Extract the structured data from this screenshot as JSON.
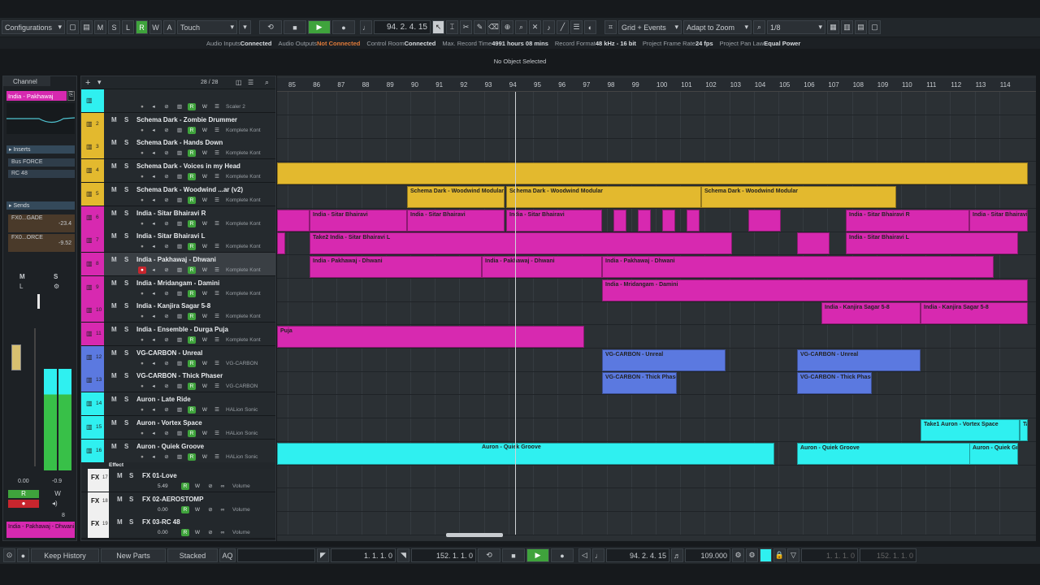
{
  "toolbar": {
    "configurations": "Configurations",
    "automation_mode": "Touch",
    "position": "94. 2. 4. 15",
    "snap_type": "Grid + Events",
    "zoom_mode": "Adapt to Zoom",
    "quantize": "1/8"
  },
  "info": {
    "audio_inputs_label": "Audio Inputs",
    "audio_inputs_value": "Connected",
    "audio_outputs_label": "Audio Outputs",
    "audio_outputs_value": "Not Connected",
    "control_room_label": "Control Room",
    "control_room_value": "Connected",
    "max_record_label": "Max. Record Time",
    "max_record_value": "4991 hours 08 mins",
    "record_format_label": "Record Format",
    "record_format_value": "48 kHz - 16 bit",
    "frame_rate_label": "Project Frame Rate",
    "frame_rate_value": "24 fps",
    "pan_law_label": "Project Pan Law",
    "pan_law_value": "Equal Power"
  },
  "object_line": "No Object Selected",
  "inspector": {
    "tab": "Channel",
    "track_name": "India - Pakhawaj",
    "inserts_label": "Inserts",
    "insert1": "Bus FORCE",
    "insert2": "RC 48",
    "sends_label": "Sends",
    "send1": "FX0...GADE",
    "send1_val": "-23.4",
    "send2": "FX0...ORCE",
    "send2_val": "-9.52",
    "fader_val": "0.00",
    "pan_val": "-0.9",
    "footer_name": "India - Pakhawaj - Dhwani",
    "count": "8"
  },
  "tracklist": {
    "counter": "28 / 28",
    "tracks": [
      {
        "num": "",
        "name": "",
        "inst": "Scaler 2"
      },
      {
        "num": "2",
        "name": "Schema Dark - Zombie Drummer",
        "inst": "Komplete Kont"
      },
      {
        "num": "3",
        "name": "Schema Dark - Hands Down",
        "inst": "Komplete Kont"
      },
      {
        "num": "4",
        "name": "Schema Dark - Voices in my Head",
        "inst": "Komplete Kont"
      },
      {
        "num": "5",
        "name": "Schema Dark - Woodwind ...ar (v2)",
        "inst": "Komplete Kont"
      },
      {
        "num": "6",
        "name": "India - Sitar Bhairavi R",
        "inst": "Komplete Kont"
      },
      {
        "num": "7",
        "name": "India - Sitar Bhairavi L",
        "inst": "Komplete Kont"
      },
      {
        "num": "8",
        "name": "India - Pakhawaj - Dhwani",
        "inst": "Komplete Kont"
      },
      {
        "num": "9",
        "name": "India - Mridangam - Damini",
        "inst": "Komplete Kont"
      },
      {
        "num": "10",
        "name": "India - Kanjira Sagar 5-8",
        "inst": "Komplete Kont"
      },
      {
        "num": "11",
        "name": "India - Ensemble - Durga Puja",
        "inst": "Komplete Kont"
      },
      {
        "num": "12",
        "name": "VG-CARBON - Unreal",
        "inst": "VG-CARBON"
      },
      {
        "num": "13",
        "name": "VG-CARBON - Thick Phaser",
        "inst": "VG-CARBON"
      },
      {
        "num": "14",
        "name": "Auron - Late Ride",
        "inst": "HALion Sonic"
      },
      {
        "num": "15",
        "name": "Auron - Vortex Space",
        "inst": "HALion Sonic"
      },
      {
        "num": "16",
        "name": "Auron - Quiek Groove",
        "inst": "HALion Sonic"
      }
    ],
    "effect_folder": "Effect",
    "fx": [
      {
        "num": "17",
        "name": "FX 01-Love",
        "val": "5.49",
        "inst": "Volume"
      },
      {
        "num": "18",
        "name": "FX 02-AEROSTOMP",
        "val": "0.00",
        "inst": "Volume"
      },
      {
        "num": "19",
        "name": "FX 03-RC 48",
        "val": "0.00",
        "inst": "Volume"
      }
    ]
  },
  "ruler": [
    "85",
    "86",
    "87",
    "88",
    "89",
    "90",
    "91",
    "92",
    "93",
    "94",
    "95",
    "96",
    "97",
    "98",
    "99",
    "100",
    "101",
    "102",
    "103",
    "104",
    "105",
    "106",
    "107",
    "108",
    "109",
    "110",
    "111",
    "112",
    "113",
    "114"
  ],
  "events": {
    "woodwind1": "Schema Dark - Woodwind Modular",
    "woodwind2": "Schema Dark - Woodwind Modular",
    "woodwind3": "Schema Dark - Woodwind Modular",
    "sitar_r1": "India - Sitar Bhairavi",
    "sitar_r2": "India - Sitar Bhairavi",
    "sitar_r3": "India - Sitar Bhairavi",
    "sitar_r4": "India - Sitar Bhairavi R",
    "sitar_r5": "India - Sitar Bhairavi",
    "sitar_l1": "Take2 India - Sitar Bhairavi L",
    "sitar_l2": "India - Sitar Bhairavi L",
    "pak1": "India - Pakhawaj - Dhwani",
    "pak2": "India - Pakhawaj - Dhwani",
    "pak3": "India - Pakhawaj - Dhwani",
    "mrid": "India - Mridangam - Damini",
    "kanj1": "India - Kanjira Sagar 5-8",
    "kanj2": "India - Kanjira Sagar 5-8",
    "durga": "Puja",
    "unreal1": "VG-CARBON - Unreal",
    "unreal2": "VG-CARBON - Unreal",
    "thick1": "VG-CARBON - Thick Phaser",
    "thick2": "VG-CARBON - Thick Phaser",
    "vortex": "Take1 Auron - Vortex Space",
    "vortex2": "Ta",
    "quiek1": "Auron - Quiek Groove",
    "quiek2": "Auron - Quiek Groove",
    "quiek3": "Auron - Quiek Gr"
  },
  "bottom": {
    "keep_history": "Keep History",
    "new_parts": "New Parts",
    "stacked": "Stacked",
    "left_locator": "1. 1. 1. 0",
    "right_locator": "152. 1. 1. 0",
    "position": "94. 2. 4. 15",
    "tempo": "109.000",
    "pos2": "1. 1. 1. 0",
    "pos3": "152. 1. 1. 0"
  },
  "colors": {
    "yellow": "#e3b92e",
    "magenta": "#d729b0",
    "blue": "#5b79e0",
    "cyan": "#2ff0f0",
    "green": "#3fa33c"
  }
}
